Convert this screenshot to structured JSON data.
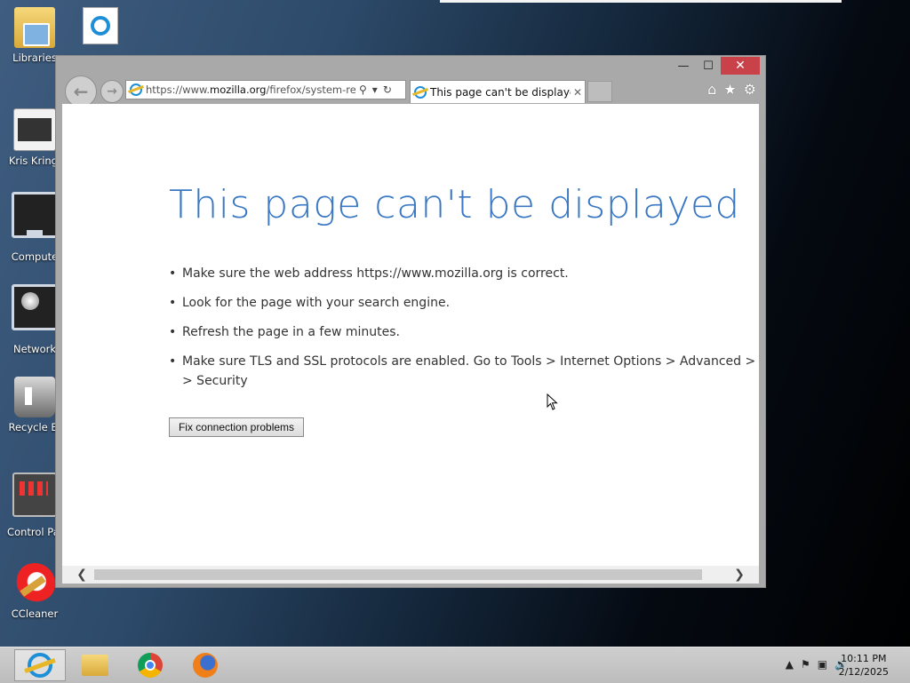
{
  "desktop": {
    "icons": [
      {
        "label": "Libraries",
        "icon": "libraries-icon"
      },
      {
        "label": "Kris Kringl",
        "icon": "kris-kringle-icon"
      },
      {
        "label": "Compute",
        "icon": "computer-icon"
      },
      {
        "label": "Network",
        "icon": "network-icon"
      },
      {
        "label": "Recycle Bi",
        "icon": "recycle-bin-icon"
      },
      {
        "label": "Control Pai",
        "icon": "control-panel-icon"
      },
      {
        "label": "CCleaner",
        "icon": "ccleaner-icon"
      },
      {
        "label": "",
        "icon": "internet-explorer-shortcut-icon"
      }
    ]
  },
  "browser": {
    "address_prefix": "https://www.",
    "address_domain": "mozilla.org",
    "address_suffix": "/firefox/system-requ",
    "tab_title": "This page can't be displayed",
    "controls": {
      "minimize": "—",
      "maximize": "☐",
      "close": "✕"
    }
  },
  "page": {
    "title": "This page can't be displayed",
    "bullets": [
      "Make sure the web address https://www.mozilla.org is correct.",
      "Look for the page with your search engine.",
      "Refresh the page in a few minutes.",
      "Make sure TLS and SSL protocols are enabled. Go to Tools > Internet Options > Advanced > Sett",
      "> Security"
    ],
    "fix_button": "Fix connection problems"
  },
  "taskbar": {
    "apps": [
      "internet-explorer-icon",
      "file-explorer-icon",
      "chrome-icon",
      "firefox-icon"
    ],
    "time": "10:11 PM",
    "date": "2/12/2025"
  },
  "colors": {
    "title_blue": "#3a78c3",
    "close_red": "#c9424a"
  }
}
